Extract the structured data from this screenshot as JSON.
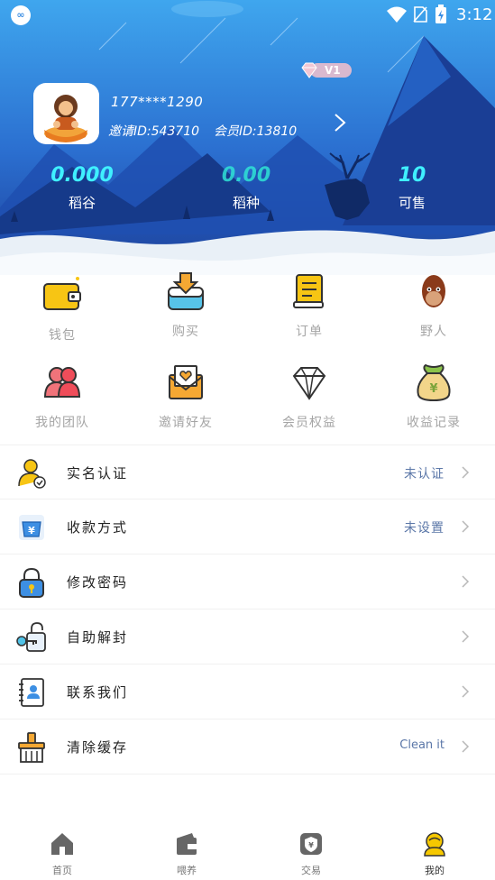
{
  "status_bar": {
    "time": "3:12"
  },
  "profile": {
    "phone": "177****1290",
    "invite_id": "邀请ID:543710",
    "member_id": "会员ID:13810",
    "vip_level": "V1"
  },
  "stats": [
    {
      "value": "0.000",
      "label": "稻谷"
    },
    {
      "value": "0.00",
      "label": "稻种"
    },
    {
      "value": "10",
      "label": "可售"
    }
  ],
  "grid": [
    {
      "label": "钱包",
      "icon": "wallet-icon"
    },
    {
      "label": "购买",
      "icon": "buy-icon"
    },
    {
      "label": "订单",
      "icon": "order-icon"
    },
    {
      "label": "野人",
      "icon": "ape-icon"
    },
    {
      "label": "我的团队",
      "icon": "team-icon"
    },
    {
      "label": "邀请好友",
      "icon": "invite-icon"
    },
    {
      "label": "会员权益",
      "icon": "diamond-icon"
    },
    {
      "label": "收益记录",
      "icon": "money-bag-icon"
    }
  ],
  "list": [
    {
      "title": "实名认证",
      "status": "未认证",
      "icon": "verify-user-icon"
    },
    {
      "title": "收款方式",
      "status": "未设置",
      "icon": "payment-icon"
    },
    {
      "title": "修改密码",
      "status": "",
      "icon": "lock-icon"
    },
    {
      "title": "自助解封",
      "status": "",
      "icon": "unlock-key-icon"
    },
    {
      "title": "联系我们",
      "status": "",
      "icon": "contact-book-icon"
    },
    {
      "title": "清除缓存",
      "status": "Clean it",
      "icon": "broom-icon"
    }
  ],
  "bottom_nav": [
    {
      "label": "首页",
      "icon": "home-icon"
    },
    {
      "label": "喂养",
      "icon": "feed-icon"
    },
    {
      "label": "交易",
      "icon": "trade-icon"
    },
    {
      "label": "我的",
      "icon": "me-icon",
      "active": true
    }
  ],
  "colors": {
    "header_top": "#3a9be8",
    "header_mid": "#2a6cc8",
    "stat_value": "#3ff0ff",
    "status_text": "#5b77a8",
    "grid_label": "#a5a5a5",
    "active_nav": "#f6c800"
  }
}
